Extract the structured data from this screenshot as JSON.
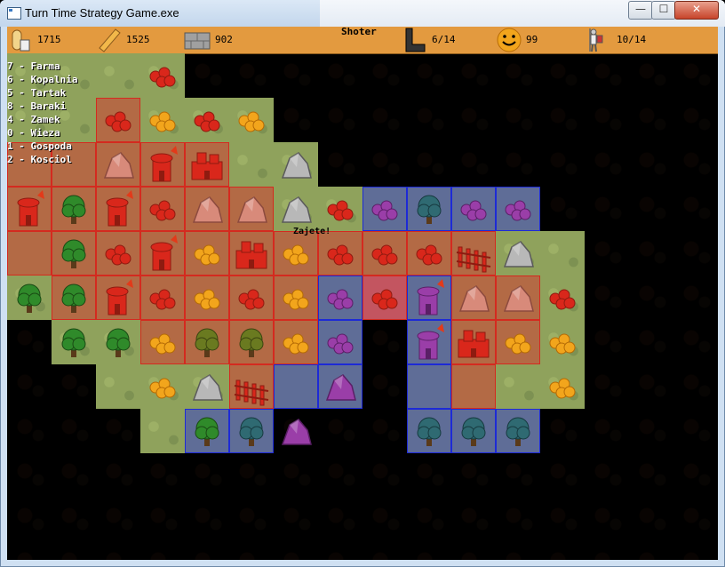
{
  "window": {
    "title": "Turn Time Strategy Game.exe",
    "controls": {
      "minimize": "—",
      "maximize": "☐",
      "close": "✕"
    }
  },
  "resources": {
    "food": "1715",
    "wood": "1525",
    "stone": "902",
    "unit_name": "Shoter",
    "movement": "6/14",
    "happiness": "99",
    "army": "10/14"
  },
  "legend": [
    "7 - Farma",
    "6 - Kopalnia",
    "5 - Tartak",
    "8 - Baraki",
    "4 - Zamek",
    "0 - Wieza",
    "1 - Gospoda",
    "2 - Kosciol"
  ],
  "status_message": "Zajete!",
  "colors": {
    "grass": "#8fa25c",
    "player_territory": "#b36a45",
    "enemy_territory": "#5f6d97",
    "selected_tile": "#c35560",
    "topbar": "#e39a3f"
  },
  "map": {
    "tiles": [
      [
        "g",
        "g",
        "g",
        "g",
        "_",
        "_",
        "_",
        "_",
        "_",
        "_",
        "_",
        "_",
        "_",
        "_",
        "_",
        "_"
      ],
      [
        "g",
        "g",
        "r",
        "g",
        "g",
        "g",
        "_",
        "_",
        "_",
        "_",
        "_",
        "_",
        "_",
        "_",
        "_",
        "_"
      ],
      [
        "r",
        "r",
        "r",
        "r",
        "r",
        "g",
        "g",
        "_",
        "_",
        "_",
        "_",
        "_",
        "_",
        "_",
        "_",
        "_"
      ],
      [
        "r",
        "r",
        "r",
        "r",
        "r",
        "r",
        "g",
        "g",
        "b",
        "b",
        "b",
        "b",
        "_",
        "_",
        "_",
        "_"
      ],
      [
        "r",
        "r",
        "r",
        "r",
        "r",
        "r",
        "r",
        "r",
        "r",
        "r",
        "r",
        "g",
        "g",
        "_",
        "_",
        "_"
      ],
      [
        "g",
        "r",
        "r",
        "r",
        "r",
        "r",
        "r",
        "b",
        "p",
        "b",
        "r",
        "r",
        "g",
        "_",
        "_",
        "_"
      ],
      [
        "_",
        "g",
        "g",
        "r",
        "r",
        "r",
        "r",
        "b",
        "_",
        "b",
        "r",
        "r",
        "g",
        "_",
        "_",
        "_"
      ],
      [
        "_",
        "_",
        "g",
        "g",
        "g",
        "r",
        "b",
        "b",
        "_",
        "b",
        "r",
        "g",
        "g",
        "_",
        "_",
        "_"
      ],
      [
        "_",
        "_",
        "_",
        "g",
        "b",
        "b",
        "_",
        "_",
        "_",
        "b",
        "b",
        "b",
        "_",
        "_",
        "_",
        "_"
      ]
    ],
    "objects": [
      {
        "col": 3,
        "row": 0,
        "kind": "berries",
        "tint": "red"
      },
      {
        "col": 2,
        "row": 1,
        "kind": "berries",
        "tint": "red"
      },
      {
        "col": 3,
        "row": 1,
        "kind": "berries",
        "tint": "orange"
      },
      {
        "col": 4,
        "row": 1,
        "kind": "berries",
        "tint": "red"
      },
      {
        "col": 5,
        "row": 1,
        "kind": "berries",
        "tint": "orange"
      },
      {
        "col": 2,
        "row": 2,
        "kind": "rock",
        "tint": "pink"
      },
      {
        "col": 3,
        "row": 2,
        "kind": "tower",
        "tint": "red"
      },
      {
        "col": 4,
        "row": 2,
        "kind": "castle",
        "tint": "red"
      },
      {
        "col": 6,
        "row": 2,
        "kind": "rock",
        "tint": "grey"
      },
      {
        "col": 0,
        "row": 3,
        "kind": "tower",
        "tint": "red"
      },
      {
        "col": 1,
        "row": 3,
        "kind": "tree",
        "tint": "green"
      },
      {
        "col": 2,
        "row": 3,
        "kind": "tower",
        "tint": "red"
      },
      {
        "col": 3,
        "row": 3,
        "kind": "berries",
        "tint": "red"
      },
      {
        "col": 4,
        "row": 3,
        "kind": "rock",
        "tint": "pink"
      },
      {
        "col": 5,
        "row": 3,
        "kind": "rock",
        "tint": "pink"
      },
      {
        "col": 6,
        "row": 3,
        "kind": "rock",
        "tint": "grey"
      },
      {
        "col": 7,
        "row": 3,
        "kind": "berries",
        "tint": "red"
      },
      {
        "col": 8,
        "row": 3,
        "kind": "berries",
        "tint": "purple"
      },
      {
        "col": 9,
        "row": 3,
        "kind": "tree",
        "tint": "teal"
      },
      {
        "col": 10,
        "row": 3,
        "kind": "berries",
        "tint": "purple"
      },
      {
        "col": 11,
        "row": 3,
        "kind": "berries",
        "tint": "purple"
      },
      {
        "col": 1,
        "row": 4,
        "kind": "tree",
        "tint": "green"
      },
      {
        "col": 2,
        "row": 4,
        "kind": "berries",
        "tint": "red"
      },
      {
        "col": 3,
        "row": 4,
        "kind": "tower",
        "tint": "red"
      },
      {
        "col": 4,
        "row": 4,
        "kind": "berries",
        "tint": "orange"
      },
      {
        "col": 5,
        "row": 4,
        "kind": "castle",
        "tint": "red"
      },
      {
        "col": 6,
        "row": 4,
        "kind": "berries",
        "tint": "orange"
      },
      {
        "col": 7,
        "row": 4,
        "kind": "berries",
        "tint": "red"
      },
      {
        "col": 8,
        "row": 4,
        "kind": "berries",
        "tint": "red"
      },
      {
        "col": 9,
        "row": 4,
        "kind": "berries",
        "tint": "red"
      },
      {
        "col": 10,
        "row": 4,
        "kind": "fence",
        "tint": "red"
      },
      {
        "col": 11,
        "row": 4,
        "kind": "rock",
        "tint": "grey"
      },
      {
        "col": 0,
        "row": 5,
        "kind": "tree",
        "tint": "green"
      },
      {
        "col": 1,
        "row": 5,
        "kind": "tree",
        "tint": "green"
      },
      {
        "col": 2,
        "row": 5,
        "kind": "tower",
        "tint": "red"
      },
      {
        "col": 3,
        "row": 5,
        "kind": "berries",
        "tint": "red"
      },
      {
        "col": 4,
        "row": 5,
        "kind": "berries",
        "tint": "orange"
      },
      {
        "col": 5,
        "row": 5,
        "kind": "berries",
        "tint": "red"
      },
      {
        "col": 6,
        "row": 5,
        "kind": "berries",
        "tint": "orange"
      },
      {
        "col": 7,
        "row": 5,
        "kind": "berries",
        "tint": "purple"
      },
      {
        "col": 8,
        "row": 5,
        "kind": "berries",
        "tint": "red"
      },
      {
        "col": 9,
        "row": 5,
        "kind": "tower",
        "tint": "purple"
      },
      {
        "col": 10,
        "row": 5,
        "kind": "rock",
        "tint": "pink"
      },
      {
        "col": 11,
        "row": 5,
        "kind": "rock",
        "tint": "pink"
      },
      {
        "col": 12,
        "row": 5,
        "kind": "berries",
        "tint": "red"
      },
      {
        "col": 1,
        "row": 6,
        "kind": "tree",
        "tint": "green"
      },
      {
        "col": 2,
        "row": 6,
        "kind": "tree",
        "tint": "green"
      },
      {
        "col": 3,
        "row": 6,
        "kind": "berries",
        "tint": "orange"
      },
      {
        "col": 4,
        "row": 6,
        "kind": "tree",
        "tint": "olive"
      },
      {
        "col": 5,
        "row": 6,
        "kind": "tree",
        "tint": "olive"
      },
      {
        "col": 6,
        "row": 6,
        "kind": "berries",
        "tint": "orange"
      },
      {
        "col": 7,
        "row": 6,
        "kind": "berries",
        "tint": "purple"
      },
      {
        "col": 9,
        "row": 6,
        "kind": "tower",
        "tint": "purple"
      },
      {
        "col": 10,
        "row": 6,
        "kind": "castle",
        "tint": "red"
      },
      {
        "col": 11,
        "row": 6,
        "kind": "berries",
        "tint": "orange"
      },
      {
        "col": 12,
        "row": 6,
        "kind": "berries",
        "tint": "orange"
      },
      {
        "col": 3,
        "row": 7,
        "kind": "berries",
        "tint": "orange"
      },
      {
        "col": 4,
        "row": 7,
        "kind": "rock",
        "tint": "grey"
      },
      {
        "col": 5,
        "row": 7,
        "kind": "fence",
        "tint": "red"
      },
      {
        "col": 7,
        "row": 7,
        "kind": "rock",
        "tint": "purple"
      },
      {
        "col": 12,
        "row": 7,
        "kind": "berries",
        "tint": "orange"
      },
      {
        "col": 4,
        "row": 8,
        "kind": "tree",
        "tint": "green"
      },
      {
        "col": 5,
        "row": 8,
        "kind": "tree",
        "tint": "teal"
      },
      {
        "col": 6,
        "row": 8,
        "kind": "rock",
        "tint": "purple"
      },
      {
        "col": 9,
        "row": 8,
        "kind": "tree",
        "tint": "teal"
      },
      {
        "col": 10,
        "row": 8,
        "kind": "tree",
        "tint": "teal"
      },
      {
        "col": 11,
        "row": 8,
        "kind": "tree",
        "tint": "teal"
      }
    ]
  }
}
